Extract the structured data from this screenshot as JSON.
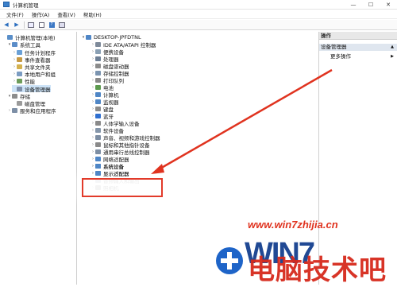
{
  "window": {
    "title": "计算机管理",
    "minimize": "—",
    "maximize": "☐",
    "close": "✕"
  },
  "menu": [
    "文件(F)",
    "操作(A)",
    "查看(V)",
    "帮助(H)"
  ],
  "left_tree": [
    {
      "label": "计算机管理(本地)",
      "level": 0,
      "arrow": "",
      "color": "#5a8fc9"
    },
    {
      "label": "系统工具",
      "level": 1,
      "arrow": "▾",
      "color": "#5b8dc8"
    },
    {
      "label": "任务计划程序",
      "level": 2,
      "arrow": "›",
      "color": "#6aa0d6"
    },
    {
      "label": "事件查看器",
      "level": 2,
      "arrow": "›",
      "color": "#c79a45"
    },
    {
      "label": "共享文件夹",
      "level": 2,
      "arrow": "›",
      "color": "#d4b14f"
    },
    {
      "label": "本地用户和组",
      "level": 2,
      "arrow": "›",
      "color": "#7b9cc2"
    },
    {
      "label": "性能",
      "level": 2,
      "arrow": "›",
      "color": "#6c9c5a"
    },
    {
      "label": "设备管理器",
      "level": 2,
      "arrow": "",
      "color": "#7e8ea8",
      "selected": true
    },
    {
      "label": "存储",
      "level": 1,
      "arrow": "▾",
      "color": "#8c8c8c"
    },
    {
      "label": "磁盘管理",
      "level": 2,
      "arrow": "",
      "color": "#9a9a9a"
    },
    {
      "label": "服务和应用程序",
      "level": 1,
      "arrow": "›",
      "color": "#7d8fa6"
    }
  ],
  "device_root": "DESKTOP-JPFDTNL",
  "devices": [
    {
      "label": "IDE ATA/ATAPI 控制器",
      "color": "#7e8a9a"
    },
    {
      "label": "便携设备",
      "color": "#8aa0b4"
    },
    {
      "label": "处理器",
      "color": "#6d7f95"
    },
    {
      "label": "磁盘驱动器",
      "color": "#8b8b8b"
    },
    {
      "label": "存储控制器",
      "color": "#7b94b0"
    },
    {
      "label": "打印队列",
      "color": "#888888"
    },
    {
      "label": "电池",
      "color": "#5c9a4e"
    },
    {
      "label": "计算机",
      "color": "#4f86c6"
    },
    {
      "label": "监视器",
      "color": "#4f86c6"
    },
    {
      "label": "键盘",
      "color": "#8a8a8a"
    },
    {
      "label": "蓝牙",
      "color": "#2f6fd0"
    },
    {
      "label": "人体学输入设备",
      "color": "#8a8a8a"
    },
    {
      "label": "软件设备",
      "color": "#8596aa"
    },
    {
      "label": "声音、视频和游戏控制器",
      "color": "#7d8ea3"
    },
    {
      "label": "鼠标和其他指针设备",
      "color": "#8a8a8a"
    },
    {
      "label": "通用串行总线控制器",
      "color": "#7d8ea3"
    },
    {
      "label": "网络适配器",
      "color": "#4f86c6"
    },
    {
      "label": "系统设备",
      "color": "#4f86c6"
    },
    {
      "label": "显示适配器",
      "color": "#4f86c6"
    },
    {
      "label": "音频输入和输出",
      "color": "#7d8ea3"
    },
    {
      "label": "照相机",
      "color": "#6f6f6f"
    }
  ],
  "actions": {
    "header": "操作",
    "sub_header": "设备管理器",
    "more": "更多操作"
  },
  "watermark": {
    "url": "www.win7zhijia.cn",
    "brand": "WIN7",
    "brand_cn": "电脑技术吧"
  },
  "colors": {
    "highlight": "#e23a2a",
    "arrow": "#e0331f",
    "selection": "#cde3f7"
  }
}
